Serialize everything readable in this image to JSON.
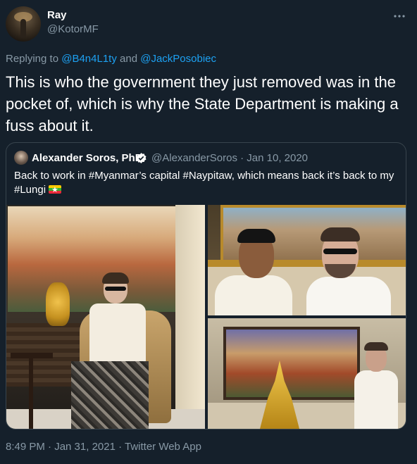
{
  "tweet": {
    "author_name": "Ray",
    "author_handle": "@KotorMF",
    "reply_prefix": "Replying to",
    "reply_to_1": "@B4n4L1ty",
    "reply_and": "and",
    "reply_to_2": "@JackPosobiec",
    "text": "This is who the government they just removed was in the pocket of, which is why the State Department is making a fuss about it.",
    "timestamp": "8:49 PM · Jan 31, 2021 · Twitter Web App",
    "more_icon": "more-horizontal-icon"
  },
  "quoted_tweet": {
    "author_name": "Alexander Soros, PhD",
    "verified_icon": "verified-badge-icon",
    "author_handle": "@AlexanderSoros · Jan 10, 2020",
    "text": "Back to work in #Myanmar’s capital #Naypitaw, which means back it’s back to my #Lungi",
    "flag_icon": "myanmar-flag-icon"
  },
  "colors": {
    "background": "#15202b",
    "link": "#1da1f2",
    "secondary_text": "#8899a6",
    "border": "#38444d",
    "verified": "#ffffff"
  }
}
